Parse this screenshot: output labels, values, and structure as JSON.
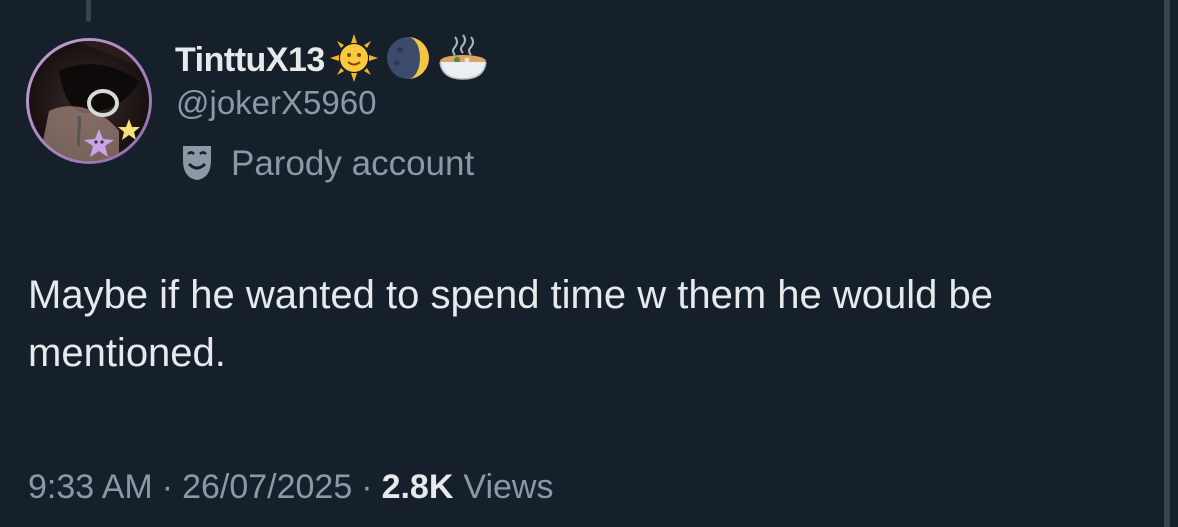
{
  "tweet": {
    "author": {
      "display_name": "TinttuX13",
      "handle": "@jokerX5960",
      "name_emojis": [
        "sun-with-face-icon",
        "moon-icon",
        "steaming-bowl-icon"
      ],
      "label": "Parody account",
      "label_icon": "theater-mask-icon"
    },
    "text": "Maybe if he wanted to spend time w them he would be mentioned.",
    "meta": {
      "time": "9:33 AM",
      "date": "26/07/2025",
      "separator": "·",
      "views_count": "2.8K",
      "views_label": "Views"
    }
  },
  "colors": {
    "background": "#15202b",
    "primary_text": "#e7e9ea",
    "secondary_text": "#8b98a5",
    "border": "#38444d"
  }
}
